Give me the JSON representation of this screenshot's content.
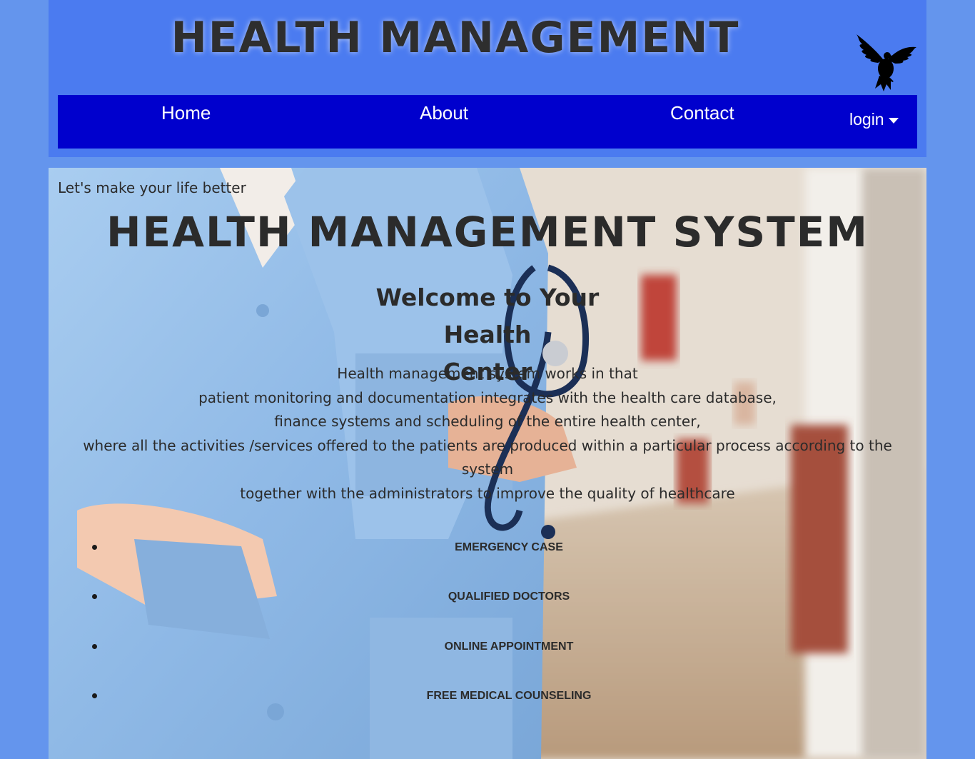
{
  "header": {
    "title": "HEALTH MANAGEMENT",
    "logo_icon": "bird-logo-icon"
  },
  "nav": {
    "home": "Home",
    "about": "About",
    "contact": "Contact",
    "login": "login"
  },
  "hero": {
    "tagline": "Let's make your life better",
    "title": "HEALTH MANAGEMENT SYSTEM",
    "welcome_line1": "Welcome to Your Health",
    "welcome_line2": "Center",
    "description": [
      "Health management system works in that",
      "patient monitoring and documentation integrates with the health care database,",
      "finance systems and scheduling of the entire health center,",
      "where all the activities /services offered to the patients are produced within a particular process according to the system",
      "together with the administrators to improve the quality of healthcare"
    ],
    "services": [
      "EMERGENCY CASE",
      "QUALIFIED DOCTORS",
      "ONLINE APPOINTMENT",
      "FREE MEDICAL COUNSELING"
    ]
  },
  "colors": {
    "page_background": "#6495ed",
    "header_background": "#4b7bf0",
    "navbar_background": "#0000cd",
    "nav_text": "#ffffff",
    "heading_text": "#2b2b2b"
  }
}
